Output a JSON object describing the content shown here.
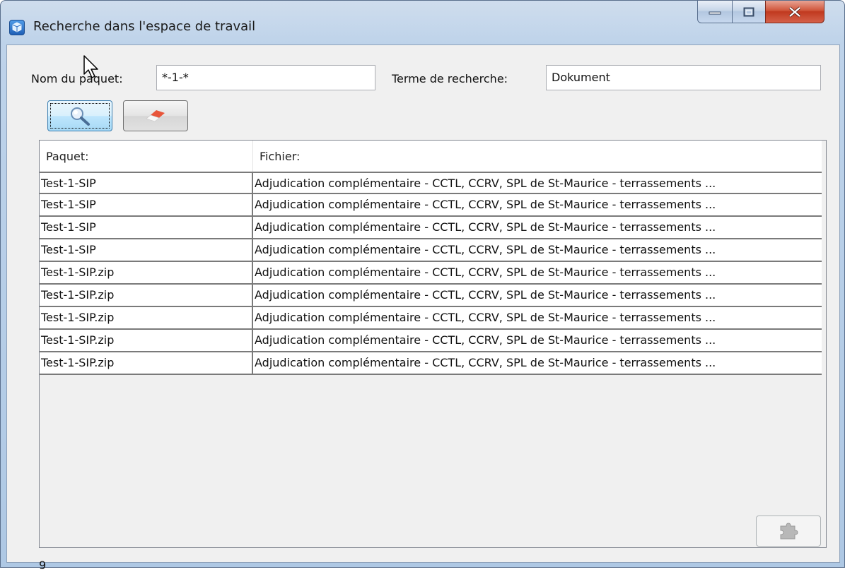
{
  "window": {
    "title": "Recherche dans l'espace de travail",
    "controls": [
      "minimize-icon",
      "maximize-icon",
      "close-icon"
    ]
  },
  "search": {
    "package_label": "Nom du paquet:",
    "package_value": "*-1-*",
    "term_label": "Terme de recherche:",
    "term_value": "Dokument"
  },
  "toolbar": {
    "search_button_icon": "magnifier-icon",
    "clear_button_icon": "eraser-icon"
  },
  "table": {
    "headers": [
      "Paquet:",
      "Fichier:"
    ],
    "rows": [
      {
        "paquet": "Test-1-SIP",
        "fichier": "Adjudication complémentaire - CCTL, CCRV, SPL de St-Maurice - terrassements ..."
      },
      {
        "paquet": "Test-1-SIP",
        "fichier": "Adjudication complémentaire - CCTL, CCRV, SPL de St-Maurice - terrassements ..."
      },
      {
        "paquet": "Test-1-SIP",
        "fichier": "Adjudication complémentaire - CCTL, CCRV, SPL de St-Maurice - terrassements ..."
      },
      {
        "paquet": "Test-1-SIP",
        "fichier": "Adjudication complémentaire - CCTL, CCRV, SPL de St-Maurice - terrassements ..."
      },
      {
        "paquet": "Test-1-SIP.zip",
        "fichier": "Adjudication complémentaire - CCTL, CCRV, SPL de St-Maurice - terrassements ..."
      },
      {
        "paquet": "Test-1-SIP.zip",
        "fichier": "Adjudication complémentaire - CCTL, CCRV, SPL de St-Maurice - terrassements ..."
      },
      {
        "paquet": "Test-1-SIP.zip",
        "fichier": "Adjudication complémentaire - CCTL, CCRV, SPL de St-Maurice - terrassements ..."
      },
      {
        "paquet": "Test-1-SIP.zip",
        "fichier": "Adjudication complémentaire - CCTL, CCRV, SPL de St-Maurice - terrassements ..."
      },
      {
        "paquet": "Test-1-SIP.zip",
        "fichier": "Adjudication complémentaire - CCTL, CCRV, SPL de St-Maurice - terrassements ..."
      }
    ]
  },
  "status": {
    "result_count": "9",
    "action_button_icon": "puzzle-icon"
  }
}
